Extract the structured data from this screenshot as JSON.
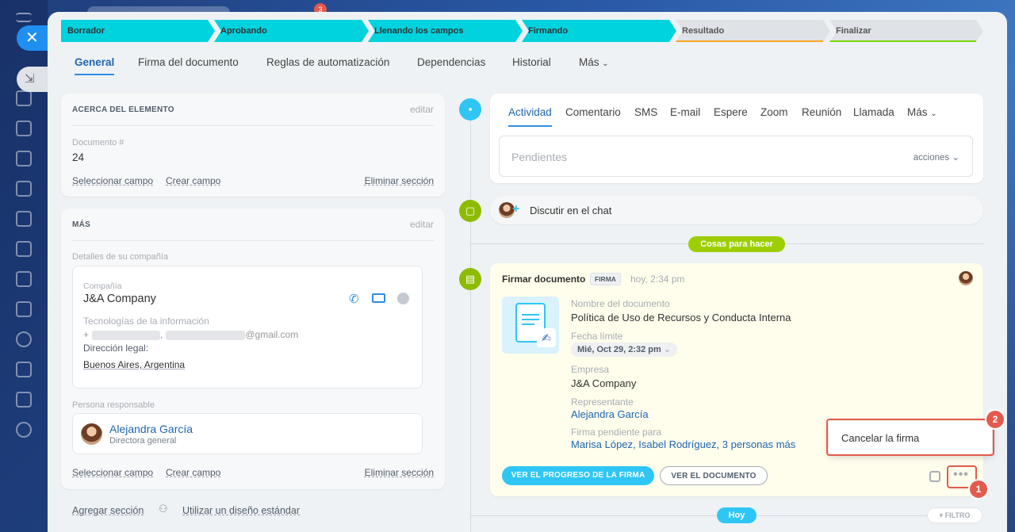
{
  "top": {
    "notification_count": "3"
  },
  "stages": [
    {
      "label": "Borrador"
    },
    {
      "label": "Aprobando"
    },
    {
      "label": "Llenando los campos"
    },
    {
      "label": "Firmando"
    },
    {
      "label": "Resultado"
    },
    {
      "label": "Finalizar"
    }
  ],
  "tabs": [
    {
      "label": "General"
    },
    {
      "label": "Firma del documento"
    },
    {
      "label": "Reglas de automatización"
    },
    {
      "label": "Dependencias"
    },
    {
      "label": "Historial"
    },
    {
      "label": "Más"
    }
  ],
  "about": {
    "title": "ACERCA DEL ELEMENTO",
    "edit": "editar",
    "doc_label": "Documento #",
    "doc_value": "24",
    "select_field": "Seleccionar campo",
    "create_field": "Crear campo",
    "delete_section": "Eliminar sección"
  },
  "more": {
    "title": "MÁS",
    "edit": "editar",
    "company_details_label": "Detalles de su compañía",
    "company_label": "Compañía",
    "company_name": "J&A Company",
    "industry": "Tecnologías de la información",
    "phone_prefix": "+",
    "comma": ",",
    "email_suffix": "@gmail.com",
    "legal_address_label": "Dirección legal:",
    "legal_address": "Buenos Aires, Argentina",
    "responsible_label": "Persona responsable",
    "responsible_name": "Alejandra García",
    "responsible_role": "Directora general",
    "select_field": "Seleccionar campo",
    "create_field": "Crear campo",
    "delete_section": "Eliminar sección"
  },
  "footer": {
    "add_section": "Agregar sección",
    "standard_layout": "Utilizar un diseño estándar"
  },
  "activity": {
    "tabs": [
      "Actividad",
      "Comentario",
      "SMS",
      "E-mail",
      "Espere",
      "Zoom",
      "Reunión",
      "Llamada",
      "Más"
    ],
    "pending_placeholder": "Pendientes",
    "actions_label": "acciones"
  },
  "chat": {
    "label": "Discutir en el chat"
  },
  "todo_pill": "Cosas para hacer",
  "sign_card": {
    "title": "Firmar documento",
    "badge": "FIRMA",
    "time": "hoy, 2:34 pm",
    "doc_name_label": "Nombre del documento",
    "doc_name": "Política de Uso de Recursos y Conducta Interna",
    "deadline_label": "Fecha límite",
    "deadline": "Mié, Oct 29, 2:32 pm",
    "company_label": "Empresa",
    "company": "J&A Company",
    "rep_label": "Representante",
    "rep": "Alejandra García",
    "pending_label": "Firma pendiente para",
    "pending": "Marisa López, Isabel Rodríguez, 3 personas más",
    "btn_progress": "VER EL PROGRESO DE LA FIRMA",
    "btn_document": "VER EL DOCUMENTO"
  },
  "context_menu": {
    "cancel": "Cancelar la firma"
  },
  "today_pill": "Hoy",
  "filter_label": "FILTRO",
  "callouts": [
    "1",
    "2"
  ],
  "colors": {
    "stage_done": "#00d2de",
    "stage_result_accent": "#f4a621",
    "stage_finish_accent": "#7bd500",
    "accent_blue": "#2f8de3",
    "green_icon": "#8dbb00",
    "pill_green": "#9dcf00",
    "callout_red": "#e25b4c"
  }
}
